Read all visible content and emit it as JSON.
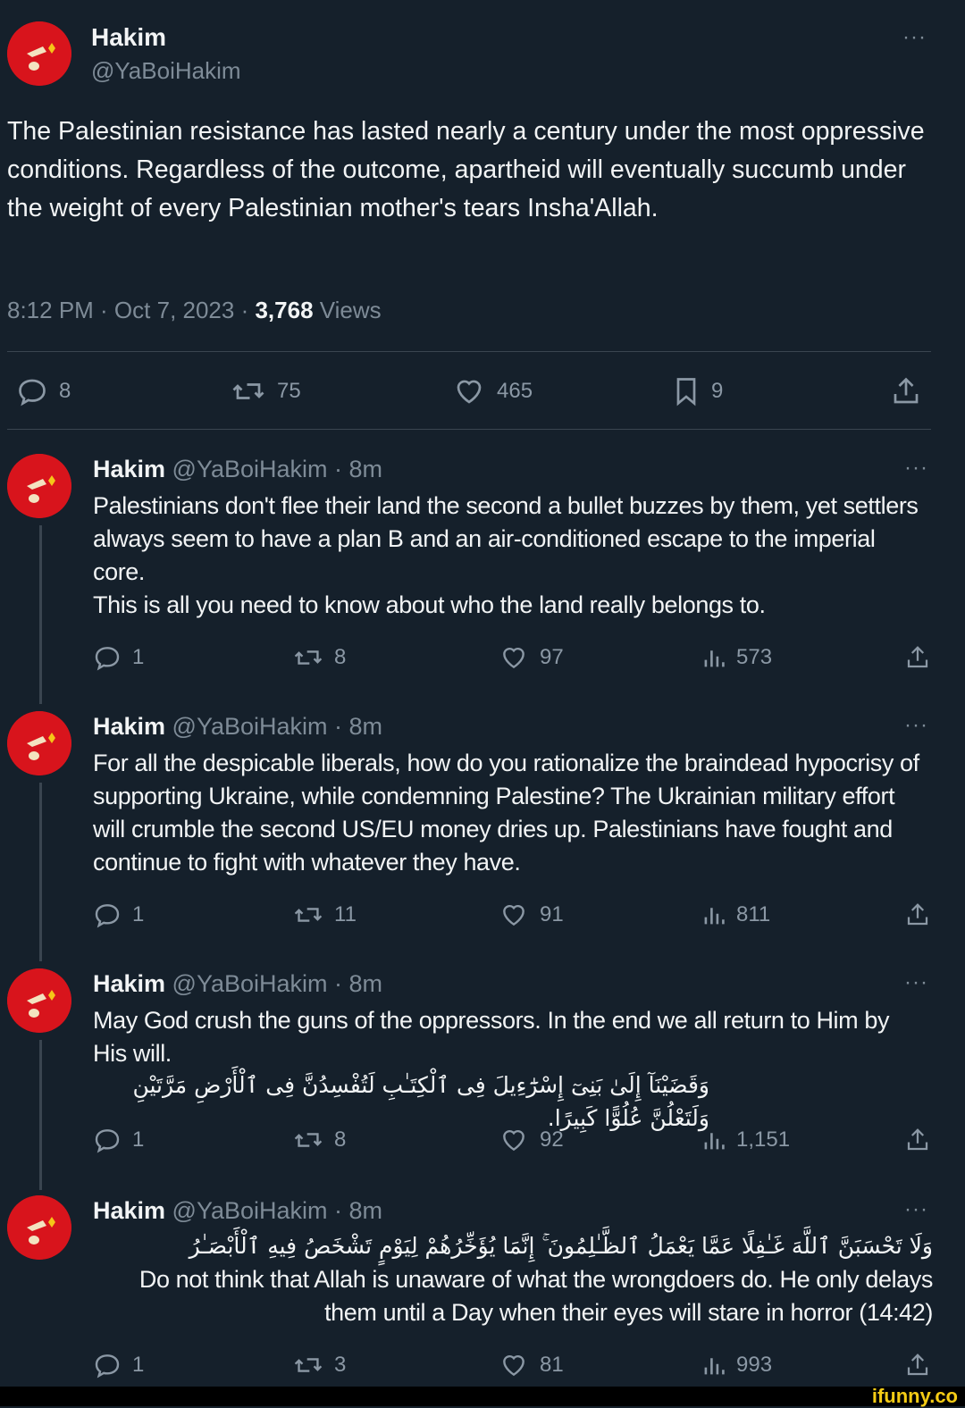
{
  "main": {
    "name": "Hakim",
    "handle": "@YaBoiHakim",
    "text": "The Palestinian resistance has lasted nearly a century under the most oppressive conditions. Regardless of the outcome, apartheid will eventually succumb under the weight of every Palestinian mother's tears Insha'Allah.",
    "time": "8:12 PM · Oct 7, 2023 · ",
    "views_count": "3,768",
    "views_label": " Views",
    "more": "···",
    "actions": {
      "replies": "8",
      "reposts": "75",
      "likes": "465",
      "bookmarks": "9"
    }
  },
  "replies": [
    {
      "name": "Hakim",
      "meta": " @YaBoiHakim · 8m",
      "more": "···",
      "text": "Palestinians don't flee their land the second a bullet buzzes by them, yet settlers always seem to have a plan B and an air-conditioned escape to the imperial core.\nThis is all you need to know about who the land really belongs to.",
      "stats": {
        "replies": "1",
        "reposts": "8",
        "likes": "97",
        "views": "573"
      }
    },
    {
      "name": "Hakim",
      "meta": " @YaBoiHakim · 8m",
      "more": "···",
      "text": "For all the despicable liberals, how do you rationalize the braindead hypocrisy of supporting Ukraine, while condemning Palestine? The Ukrainian military effort will crumble the second US/EU money dries up. Palestinians have fought and continue to fight with whatever they have.",
      "stats": {
        "replies": "1",
        "reposts": "11",
        "likes": "91",
        "views": "811"
      }
    },
    {
      "name": "Hakim",
      "meta": " @YaBoiHakim · 8m",
      "more": "···",
      "text": "May God crush the guns of the oppressors. In the end we all return to Him by His will.",
      "arabic": "وَقَضَيْنَآ إِلَىٰ بَنِىٓ إِسْرَٰٓءِيلَ فِى ٱلْكِتَـٰبِ لَتُفْسِدُنَّ فِى ٱلْأَرْضِ مَرَّتَيْنِ وَلَتَعْلُنَّ عُلُوًّا كَبِيرًا.",
      "stats": {
        "replies": "1",
        "reposts": "8",
        "likes": "92",
        "views": "1,151"
      }
    },
    {
      "name": "Hakim",
      "meta": " @YaBoiHakim · 8m",
      "more": "···",
      "arabic": "وَلَا تَحْسَبَنَّ ٱللَّهَ غَـٰفِلًا عَمَّا يَعْمَلُ ٱلظَّـٰلِمُونَ ۚ إِنَّمَا يُؤَخِّرُهُمْ لِيَوْمٍ تَشْخَصُ فِيهِ ٱلْأَبْصَـٰرُ",
      "text": "Do not think that Allah is unaware of what the wrongdoers do. He only delays them until a Day when their eyes will stare in horror (14:42)",
      "stats": {
        "replies": "1",
        "reposts": "3",
        "likes": "81",
        "views": "993"
      }
    }
  ],
  "watermark": "ifunny.co",
  "colors": {
    "background": "#15202b",
    "avatar": "#d8141c",
    "muted": "#7e8b97",
    "watermark": "#f5cc15"
  },
  "icons": [
    "reply-icon",
    "repost-icon",
    "like-icon",
    "bookmark-icon",
    "share-icon",
    "views-icon",
    "more-icon"
  ]
}
